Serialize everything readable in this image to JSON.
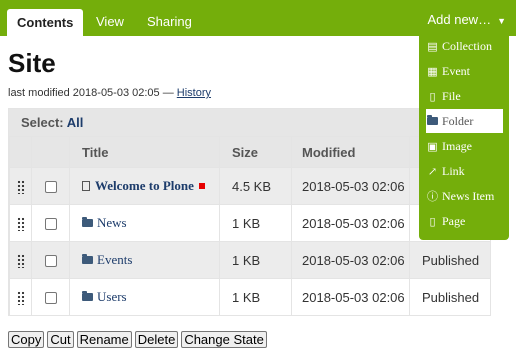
{
  "toolbar": {
    "tabs": [
      {
        "label": "Contents"
      },
      {
        "label": "View"
      },
      {
        "label": "Sharing"
      }
    ],
    "add_new_label": "Add new…",
    "caret": "▼"
  },
  "page": {
    "title": "Site",
    "byline": "last modified 2018-05-03 02:05 —",
    "history_link": "History"
  },
  "listing": {
    "select_label": "Select:",
    "select_all": "All",
    "columns": [
      "Title",
      "Size",
      "Modified"
    ],
    "rows": [
      {
        "title": "Welcome to Plone",
        "size": "4.5 KB",
        "modified": "2018-05-03 02:06",
        "state": "",
        "type": "document"
      },
      {
        "title": "News",
        "size": "1 KB",
        "modified": "2018-05-03 02:06",
        "state": "",
        "type": "folder"
      },
      {
        "title": "Events",
        "size": "1 KB",
        "modified": "2018-05-03 02:06",
        "state": "Published",
        "type": "folder"
      },
      {
        "title": "Users",
        "size": "1 KB",
        "modified": "2018-05-03 02:06",
        "state": "Published",
        "type": "folder"
      }
    ]
  },
  "buttons": {
    "copy": "Copy",
    "cut": "Cut",
    "rename": "Rename",
    "delete": "Delete",
    "change_state": "Change State"
  },
  "add_menu": {
    "items": [
      {
        "label": "Collection",
        "icon": "collection-icon"
      },
      {
        "label": "Event",
        "icon": "calendar-icon"
      },
      {
        "label": "File",
        "icon": "file-icon"
      },
      {
        "label": "Folder",
        "icon": "folder-icon"
      },
      {
        "label": "Image",
        "icon": "image-icon"
      },
      {
        "label": "Link",
        "icon": "link-icon"
      },
      {
        "label": "News Item",
        "icon": "info-icon"
      },
      {
        "label": "Page",
        "icon": "page-icon"
      }
    ]
  },
  "colors": {
    "toolbar_green": "#74ae0b",
    "link_blue": "#1d3c6b",
    "modified_flag_red": "#e60000"
  }
}
